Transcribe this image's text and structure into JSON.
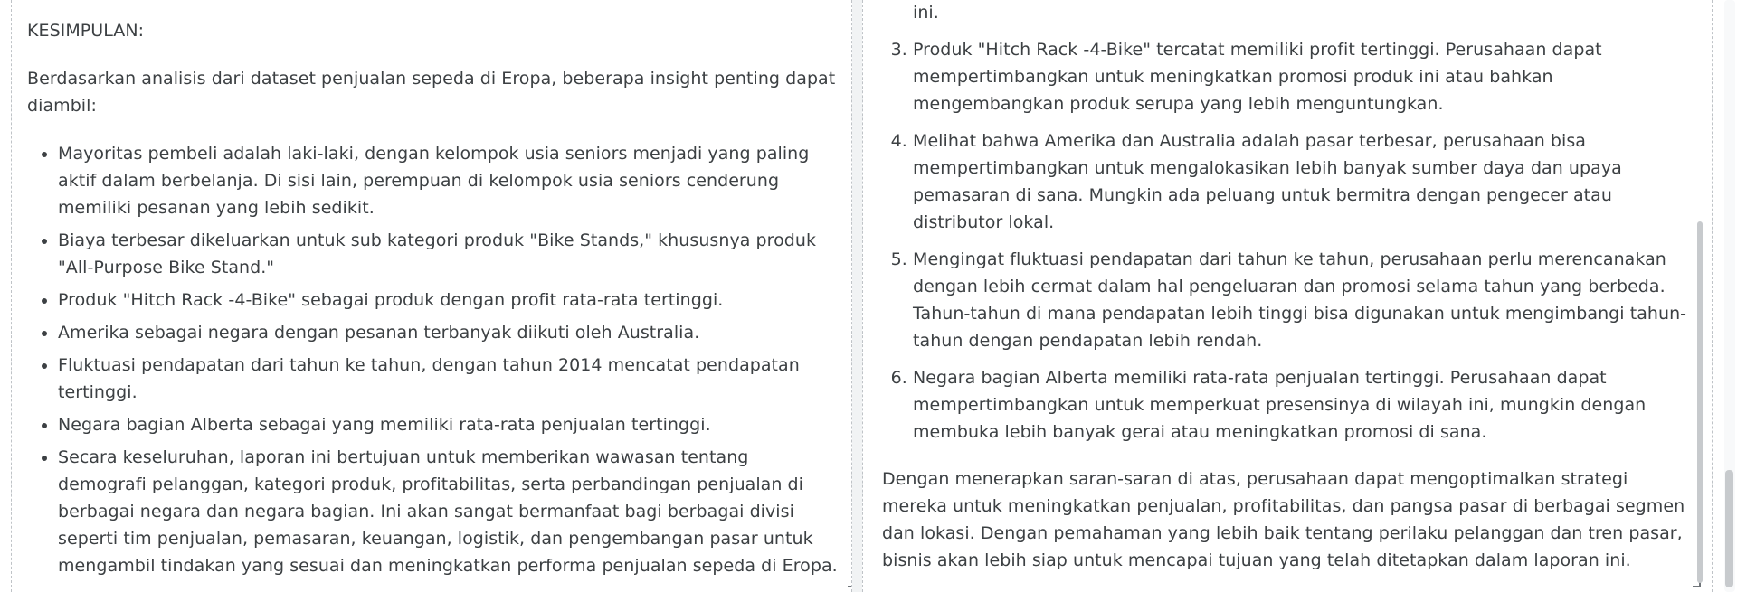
{
  "left_panel": {
    "heading": "KESIMPULAN:",
    "intro": "Berdasarkan analisis dari dataset penjualan sepeda di Eropa, beberapa insight penting dapat diambil:",
    "bullets": [
      "Mayoritas pembeli adalah laki-laki, dengan kelompok usia seniors menjadi yang paling aktif dalam berbelanja. Di sisi lain, perempuan di kelompok usia seniors cenderung memiliki pesanan yang lebih sedikit.",
      "Biaya terbesar dikeluarkan untuk sub kategori produk \"Bike Stands,\" khususnya produk \"All-Purpose Bike Stand.\"",
      "Produk \"Hitch Rack -4-Bike\" sebagai produk dengan profit rata-rata tertinggi.",
      "Amerika sebagai negara dengan pesanan terbanyak diikuti oleh Australia.",
      "Fluktuasi pendapatan dari tahun ke tahun, dengan tahun 2014 mencatat pendapatan tertinggi.",
      "Negara bagian Alberta sebagai yang memiliki rata-rata penjualan tertinggi.",
      "Secara keseluruhan, laporan ini bertujuan untuk memberikan wawasan tentang demografi pelanggan, kategori produk, profitabilitas, serta perbandingan penjualan di berbagai negara dan negara bagian. Ini akan sangat bermanfaat bagi berbagai divisi seperti tim penjualan, pemasaran, keuangan, logistik, dan pengembangan pasar untuk mengambil tindakan yang sesuai dan meningkatkan performa penjualan sepeda di Eropa."
    ]
  },
  "right_panel": {
    "continuation": "ini.",
    "numbered_items": [
      "Produk \"Hitch Rack -4-Bike\" tercatat memiliki profit tertinggi. Perusahaan dapat mempertimbangkan untuk meningkatkan promosi produk ini atau bahkan mengembangkan produk serupa yang lebih menguntungkan.",
      "Melihat bahwa Amerika dan Australia adalah pasar terbesar, perusahaan bisa mempertimbangkan untuk mengalokasikan lebih banyak sumber daya dan upaya pemasaran di sana. Mungkin ada peluang untuk bermitra dengan pengecer atau distributor lokal.",
      "Mengingat fluktuasi pendapatan dari tahun ke tahun, perusahaan perlu merencanakan dengan lebih cermat dalam hal pengeluaran dan promosi selama tahun yang berbeda. Tahun-tahun di mana pendapatan lebih tinggi bisa digunakan untuk mengimbangi tahun-tahun dengan pendapatan lebih rendah.",
      "Negara bagian Alberta memiliki rata-rata penjualan tertinggi. Perusahaan dapat mempertimbangkan untuk memperkuat presensinya di wilayah ini, mungkin dengan membuka lebih banyak gerai atau meningkatkan promosi di sana."
    ],
    "numbered_start": 3,
    "closing": "Dengan menerapkan saran-saran di atas, perusahaan dapat mengoptimalkan strategi mereka untuk meningkatkan penjualan, profitabilitas, dan pangsa pasar di berbagai segmen dan lokasi. Dengan pemahaman yang lebih baik tentang perilaku pelanggan dan tren pasar, bisnis akan lebih siap untuk mencapai tujuan yang telah ditetapkan dalam laporan ini."
  },
  "colors": {
    "text": "#3c4043",
    "border": "#bfc3c7",
    "scrollbar_thumb": "#c7cacd"
  }
}
